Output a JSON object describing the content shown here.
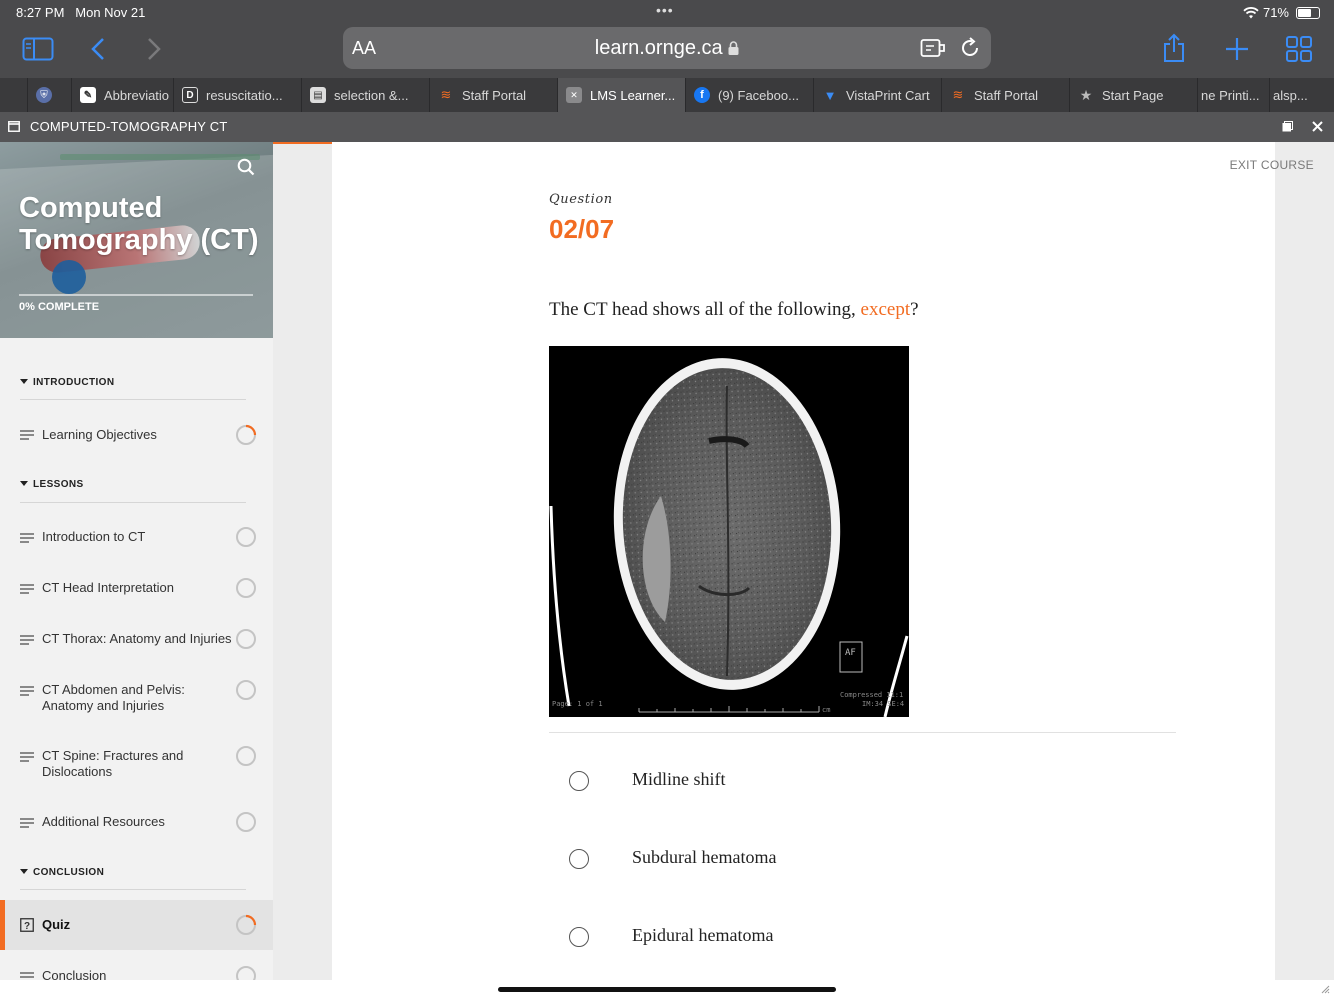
{
  "status_bar": {
    "time": "8:27 PM",
    "date": "Mon Nov 21",
    "battery": "71%",
    "battery_level": 0.71
  },
  "browser": {
    "text_size_label": "AA",
    "url": "learn.ornge.ca",
    "tabs": [
      {
        "label": "",
        "favicon": "generic-icon"
      },
      {
        "label": "",
        "favicon": "shield-icon"
      },
      {
        "label": "Abbreviatio",
        "favicon": "app-icon"
      },
      {
        "label": "resuscitatio...",
        "favicon": "d-icon"
      },
      {
        "label": "selection &...",
        "favicon": "doc-icon"
      },
      {
        "label": "Staff Portal",
        "favicon": "portal-icon"
      },
      {
        "label": "LMS Learner...",
        "favicon": "lms-icon",
        "active": true
      },
      {
        "label": "(9) Faceboo...",
        "favicon": "facebook-icon"
      },
      {
        "label": "VistaPrint Cart",
        "favicon": "vistaprint-icon"
      },
      {
        "label": "Staff Portal",
        "favicon": "portal-icon"
      },
      {
        "label": "Start Page",
        "favicon": "star-icon"
      },
      {
        "label": "ne Printi...",
        "favicon": ""
      },
      {
        "label": "alsp...",
        "favicon": ""
      }
    ]
  },
  "app": {
    "title": "COMPUTED-TOMOGRAPHY CT"
  },
  "sidebar": {
    "course_title_line1": "Computed",
    "course_title_line2": "Tomography (CT)",
    "progress_label": "0% COMPLETE",
    "progress": 0,
    "sections": [
      {
        "title": "INTRODUCTION",
        "lessons": [
          {
            "label": "Learning Objectives",
            "status": "in-progress"
          }
        ]
      },
      {
        "title": "LESSONS",
        "lessons": [
          {
            "label": "Introduction to CT",
            "status": "not-started"
          },
          {
            "label": "CT Head Interpretation",
            "status": "not-started"
          },
          {
            "label": "CT Thorax: Anatomy and Injuries",
            "status": "not-started"
          },
          {
            "label": "CT Abdomen and Pelvis: Anatomy and Injuries",
            "status": "not-started"
          },
          {
            "label": "CT Spine: Fractures and Dislocations",
            "status": "not-started"
          },
          {
            "label": "Additional Resources",
            "status": "not-started"
          }
        ]
      },
      {
        "title": "CONCLUSION",
        "lessons": [
          {
            "label": "Quiz",
            "status": "in-progress",
            "active": true
          },
          {
            "label": "Conclusion",
            "status": "not-started"
          }
        ]
      }
    ]
  },
  "main": {
    "exit_label": "EXIT COURSE",
    "question_label": "Question",
    "question_number": "02/07",
    "question_text_before": "The CT head shows all of the following, ",
    "question_text_accent": "except",
    "question_text_after": "?",
    "image_captions": {
      "page": "Page: 1 of 1",
      "compressed": "Compressed 11:1",
      "im": "IM:34 SE:4",
      "unit": "cm",
      "marker": "AF"
    },
    "options": [
      "Midline shift",
      "Subdural hematoma",
      "Epidural hematoma"
    ]
  },
  "colors": {
    "accent": "#f26c22",
    "ios_blue": "#3b8cf5"
  }
}
